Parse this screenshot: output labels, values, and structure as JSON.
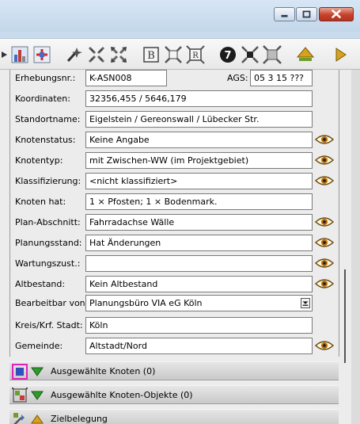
{
  "form": {
    "erhebungsnr": {
      "label": "Erhebungsnr.:",
      "value": "K-ASN008"
    },
    "ags": {
      "label": "AGS:",
      "value": "05 3 15 ???"
    },
    "koordinaten": {
      "label": "Koordinaten:",
      "value": "32356,455 / 5646,179"
    },
    "standortname": {
      "label": "Standortname:",
      "value": "Eigelstein / Gereonswall / Lübecker Str."
    },
    "knotenstatus": {
      "label": "Knotenstatus:",
      "value": "Keine Angabe"
    },
    "knotentyp": {
      "label": "Knotentyp:",
      "value": "mit Zwischen-WW (im Projektgebiet)"
    },
    "klassifizierung": {
      "label": "Klassifizierung:",
      "value": "<nicht klassifiziert>"
    },
    "knoten_hat": {
      "label": "Knoten hat:",
      "value": "1 × Pfosten; 1 × Bodenmark."
    },
    "plan_abschnitt": {
      "label": "Plan-Abschnitt:",
      "value": "Fahrradachse Wälle"
    },
    "planungsstand": {
      "label": "Planungsstand:",
      "value": "Hat Änderungen"
    },
    "wartungszust": {
      "label": "Wartungszust.:",
      "value": ""
    },
    "altbestand": {
      "label": "Altbestand:",
      "value": "Kein Altbestand"
    },
    "bearbeitbar_von": {
      "label": "Bearbeitbar von:",
      "value": "Planungsbüro VIA eG Köln"
    },
    "kreis": {
      "label": "Kreis/Krf. Stadt:",
      "value": "Köln"
    },
    "gemeinde": {
      "label": "Gemeinde:",
      "value": "Altstadt/Nord"
    }
  },
  "sections": [
    {
      "label": "Ausgewählte Knoten (0)",
      "triangle": "down"
    },
    {
      "label": "Ausgewählte Knoten-Objekte (0)",
      "triangle": "down"
    },
    {
      "label": "Zielbelegung",
      "triangle": "up"
    }
  ],
  "icons": {
    "eye": "eye-icon",
    "window_min": "minimize-icon",
    "window_max": "maximize-icon",
    "window_close": "close-icon"
  },
  "colors": {
    "close_button": "#c5412b",
    "titlebar": "#c9dced",
    "panel": "#ececec",
    "triangle_green": "#2e9b2e",
    "triangle_amber": "#d6a21c"
  }
}
